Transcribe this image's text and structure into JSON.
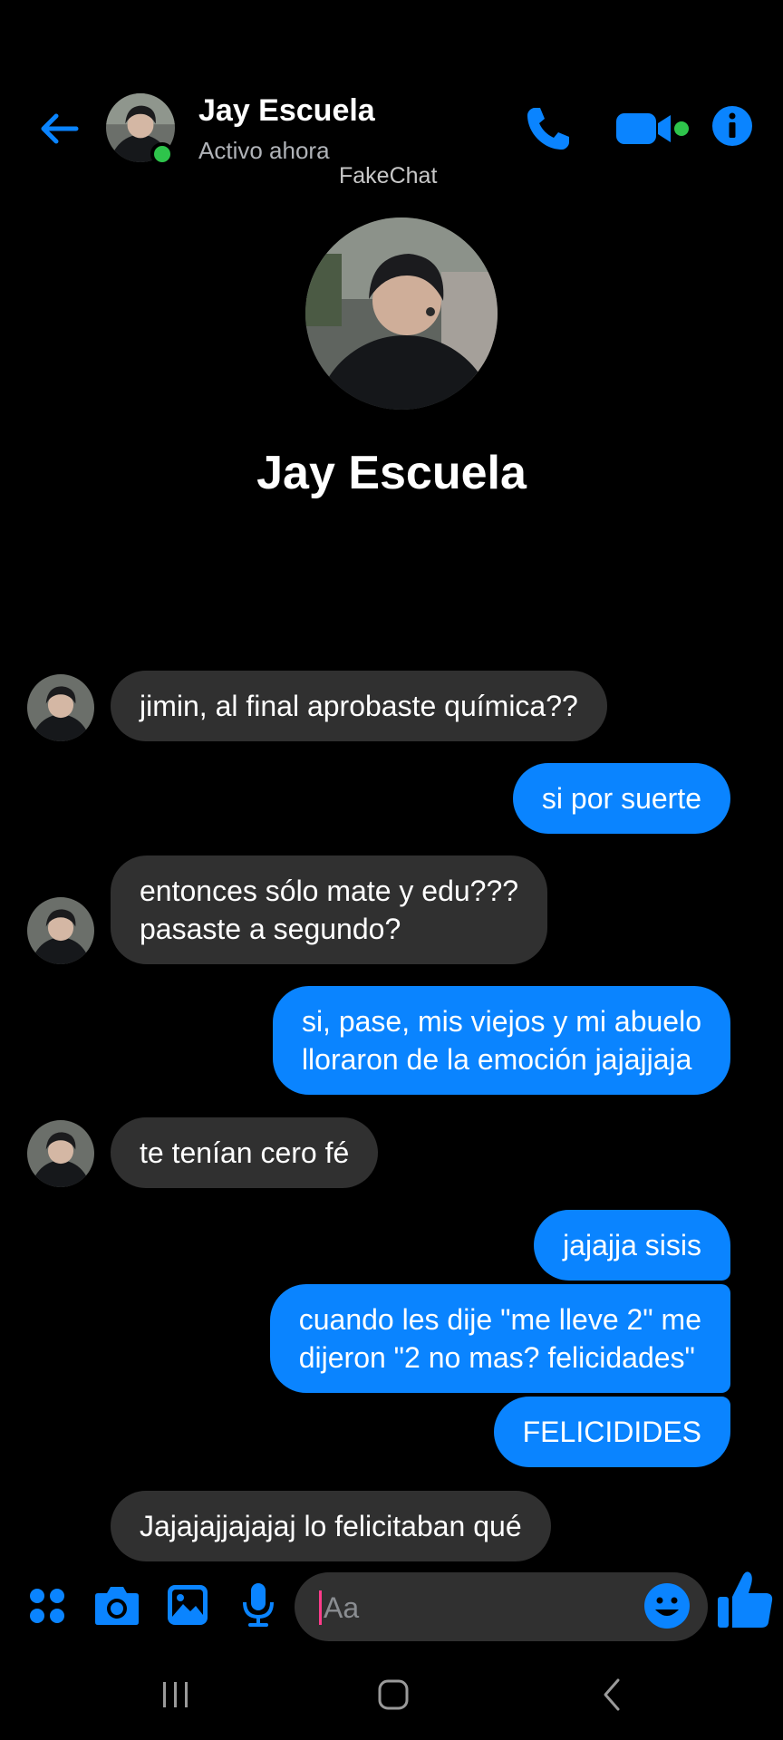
{
  "header": {
    "contact_name": "Jay Escuela",
    "status": "Activo ahora",
    "watermark": "FakeChat"
  },
  "profile": {
    "name": "Jay Escuela"
  },
  "messages": [
    {
      "from": "contact",
      "text": "jimin, al final aprobaste química??"
    },
    {
      "from": "me",
      "text": "si por suerte"
    },
    {
      "from": "contact",
      "lines": [
        "entonces sólo mate y edu???",
        "pasaste a segundo?"
      ]
    },
    {
      "from": "me",
      "lines": [
        "si, pase, mis viejos y mi abuelo",
        "lloraron de la emoción jajajjaja"
      ]
    },
    {
      "from": "contact",
      "text": "te tenían cero fé"
    },
    {
      "from": "me",
      "text": "jajajja sisis"
    },
    {
      "from": "me",
      "lines": [
        "cuando les dije \"me lleve 2\" me",
        "dijeron \"2 no mas? felicidades\""
      ]
    },
    {
      "from": "me",
      "text": "FELICIDIDES"
    },
    {
      "from": "contact",
      "text": "Jajajajjajajaj lo felicitaban qué"
    }
  ],
  "composer": {
    "placeholder": "Aa"
  },
  "colors": {
    "accent": "#0a84ff",
    "incoming_bubble": "#303030",
    "online": "#2ec44b",
    "background": "#000000"
  },
  "icons": [
    "back-arrow-icon",
    "phone-icon",
    "video-camera-icon",
    "info-icon",
    "apps-icon",
    "camera-icon",
    "gallery-icon",
    "microphone-icon",
    "emoji-icon",
    "thumbs-up-icon",
    "recents-icon",
    "home-icon",
    "nav-back-icon"
  ]
}
